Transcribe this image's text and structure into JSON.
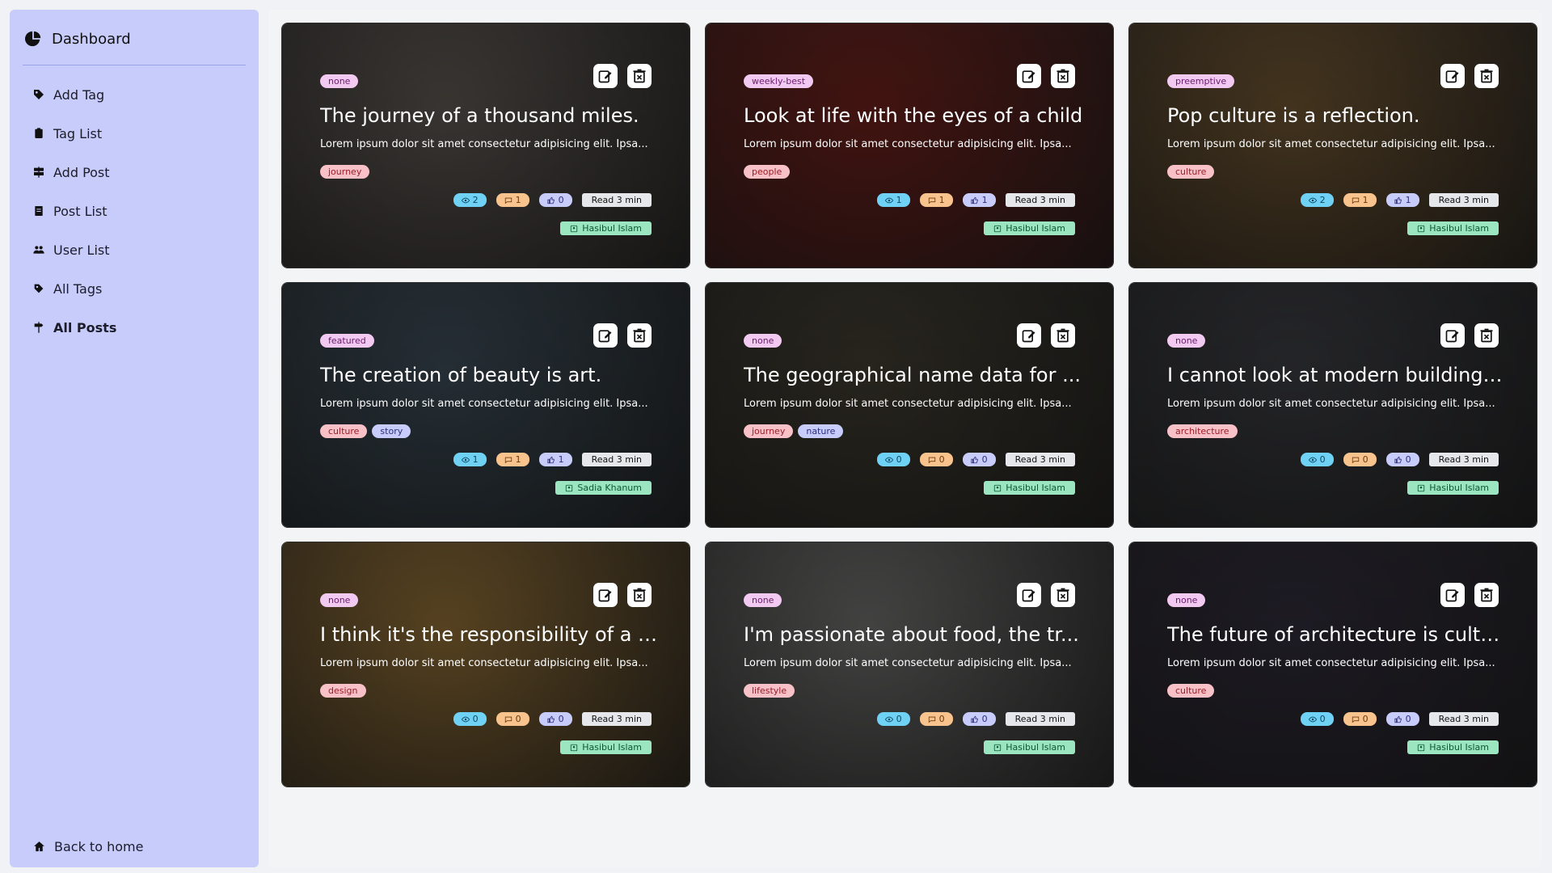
{
  "sidebar": {
    "title": "Dashboard",
    "items": [
      {
        "label": "Add Tag",
        "icon": "tag-icon"
      },
      {
        "label": "Tag List",
        "icon": "clipboard-icon"
      },
      {
        "label": "Add Post",
        "icon": "sign-icon"
      },
      {
        "label": "Post List",
        "icon": "document-icon"
      },
      {
        "label": "User List",
        "icon": "users-icon"
      },
      {
        "label": "All Tags",
        "icon": "tags-icon"
      },
      {
        "label": "All Posts",
        "icon": "signpost-icon",
        "active": true
      }
    ],
    "back_home": "Back to home"
  },
  "posts": [
    {
      "featured": "none",
      "title": "The journey of a thousand miles.",
      "excerpt": "Lorem ipsum dolor sit amet consectetur adipisicing elit. Ipsa...",
      "tags": [
        "journey"
      ],
      "views": "2",
      "comments": "1",
      "likes": "0",
      "read": "Read 3 min",
      "author": "Hasibul Islam",
      "bg": "#5b5550"
    },
    {
      "featured": "weekly-best",
      "title": "Look at life with the eyes of a child",
      "excerpt": "Lorem ipsum dolor sit amet consectetur adipisicing elit. Ipsa...",
      "tags": [
        "people"
      ],
      "views": "1",
      "comments": "1",
      "likes": "1",
      "read": "Read 3 min",
      "author": "Hasibul Islam",
      "bg": "#6a1f1a"
    },
    {
      "featured": "preemptive",
      "title": "Pop culture is a reflection.",
      "excerpt": "Lorem ipsum dolor sit amet consectetur adipisicing elit. Ipsa...",
      "tags": [
        "culture"
      ],
      "views": "2",
      "comments": "1",
      "likes": "1",
      "read": "Read 3 min",
      "author": "Hasibul Islam",
      "bg": "#6b5230"
    },
    {
      "featured": "featured",
      "title": "The creation of beauty is art.",
      "excerpt": "Lorem ipsum dolor sit amet consectetur adipisicing elit. Ipsa...",
      "tags": [
        "culture",
        "story"
      ],
      "views": "1",
      "comments": "1",
      "likes": "1",
      "read": "Read 3 min",
      "author": "Sadia Khanum",
      "bg": "#3b4a55"
    },
    {
      "featured": "none",
      "title": "The geographical name data for ...",
      "excerpt": "Lorem ipsum dolor sit amet consectetur adipisicing elit. Ipsa...",
      "tags": [
        "journey",
        "nature"
      ],
      "views": "0",
      "comments": "0",
      "likes": "0",
      "read": "Read 3 min",
      "author": "Hasibul Islam",
      "bg": "#3e3a2f"
    },
    {
      "featured": "none",
      "title": "I cannot look at modern buildings...",
      "excerpt": "Lorem ipsum dolor sit amet consectetur adipisicing elit. Ipsa...",
      "tags": [
        "architecture"
      ],
      "views": "0",
      "comments": "0",
      "likes": "0",
      "read": "Read 3 min",
      "author": "Hasibul Islam",
      "bg": "#3a3b40"
    },
    {
      "featured": "none",
      "title": "I think it's the responsibility of a d...",
      "excerpt": "Lorem ipsum dolor sit amet consectetur adipisicing elit. Ipsa...",
      "tags": [
        "design"
      ],
      "views": "0",
      "comments": "0",
      "likes": "0",
      "read": "Read 3 min",
      "author": "Hasibul Islam",
      "bg": "#8b6a34"
    },
    {
      "featured": "none",
      "title": "I'm passionate about food, the tr...",
      "excerpt": "Lorem ipsum dolor sit amet consectetur adipisicing elit. Ipsa...",
      "tags": [
        "lifestyle"
      ],
      "views": "0",
      "comments": "0",
      "likes": "0",
      "read": "Read 3 min",
      "author": "Hasibul Islam",
      "bg": "#6b6b6a"
    },
    {
      "featured": "none",
      "title": "The future of architecture is cultu...",
      "excerpt": "Lorem ipsum dolor sit amet consectetur adipisicing elit. Ipsa...",
      "tags": [
        "culture"
      ],
      "views": "0",
      "comments": "0",
      "likes": "0",
      "read": "Read 3 min",
      "author": "Hasibul Islam",
      "bg": "#2f2b38"
    }
  ]
}
